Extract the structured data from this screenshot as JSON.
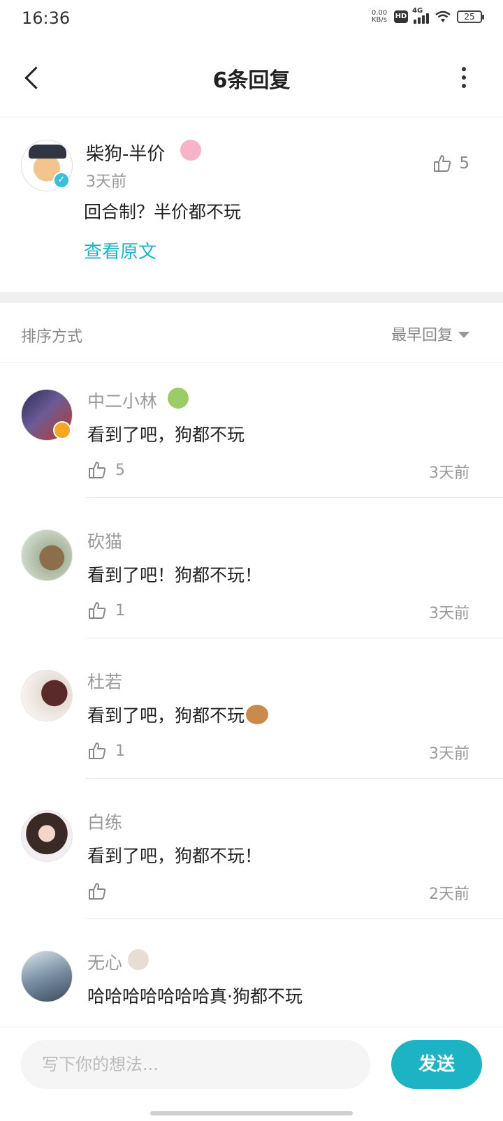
{
  "status_bar": {
    "time": "16:36",
    "net_speed_value": "0.00",
    "net_speed_unit": "KB/s",
    "hd": "HD",
    "network": "4G",
    "battery": "25"
  },
  "nav": {
    "title": "6条回复"
  },
  "op": {
    "name": "柴狗-半价",
    "time": "3天前",
    "likes": "5",
    "content": "回合制？半价都不玩",
    "view_original": "查看原文"
  },
  "sort": {
    "label": "排序方式",
    "selected": "最早回复"
  },
  "replies": [
    {
      "name": "中二小林",
      "content": "看到了吧，狗都不玩",
      "likes": "5",
      "time": "3天前"
    },
    {
      "name": "砍猫",
      "content": "看到了吧！狗都不玩！",
      "likes": "1",
      "time": "3天前"
    },
    {
      "name": "杜若",
      "content": "看到了吧，狗都不玩",
      "likes": "1",
      "time": "3天前"
    },
    {
      "name": "白练",
      "content": "看到了吧，狗都不玩！",
      "likes": "",
      "time": "2天前"
    },
    {
      "name": "无心",
      "content": "哈哈哈哈哈哈哈真·狗都不玩",
      "likes": "",
      "time": ""
    }
  ],
  "composer": {
    "placeholder": "写下你的想法...",
    "send_label": "发送"
  },
  "colors": {
    "accent": "#1cb3c4",
    "link": "#1fb4c7",
    "muted_text": "#999999"
  }
}
